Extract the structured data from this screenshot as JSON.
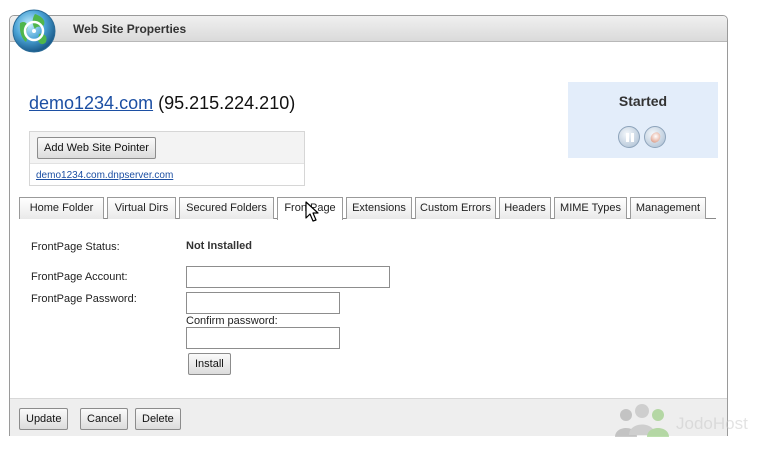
{
  "window": {
    "title": "Web Site Properties",
    "icon": "globe-icon"
  },
  "site": {
    "domain": "demo1234.com",
    "ip": "(95.215.224.210)"
  },
  "pointer": {
    "add_button": "Add Web Site Pointer",
    "link": "demo1234.com.dnpserver.com"
  },
  "status": {
    "label": "Started",
    "pause_icon": "pause-icon",
    "stop_icon": "stop-icon"
  },
  "tabs": [
    {
      "label": "Home Folder"
    },
    {
      "label": "Virtual Dirs"
    },
    {
      "label": "Secured Folders"
    },
    {
      "label": "FrontPage",
      "active": true
    },
    {
      "label": "Extensions"
    },
    {
      "label": "Custom Errors"
    },
    {
      "label": "Headers"
    },
    {
      "label": "MIME Types"
    },
    {
      "label": "Management"
    }
  ],
  "form": {
    "status_label": "FrontPage Status:",
    "status_value": "Not Installed",
    "account_label": "FrontPage Account:",
    "account_value": "",
    "password_label": "FrontPage Password:",
    "password_value": "",
    "confirm_label": "Confirm password:",
    "confirm_value": "",
    "install_button": "Install"
  },
  "footer": {
    "update": "Update",
    "cancel": "Cancel",
    "delete": "Delete"
  },
  "watermark": {
    "text": "JodoHost"
  },
  "colors": {
    "link": "#1c4fa3",
    "status_box": "#e3edfa"
  }
}
